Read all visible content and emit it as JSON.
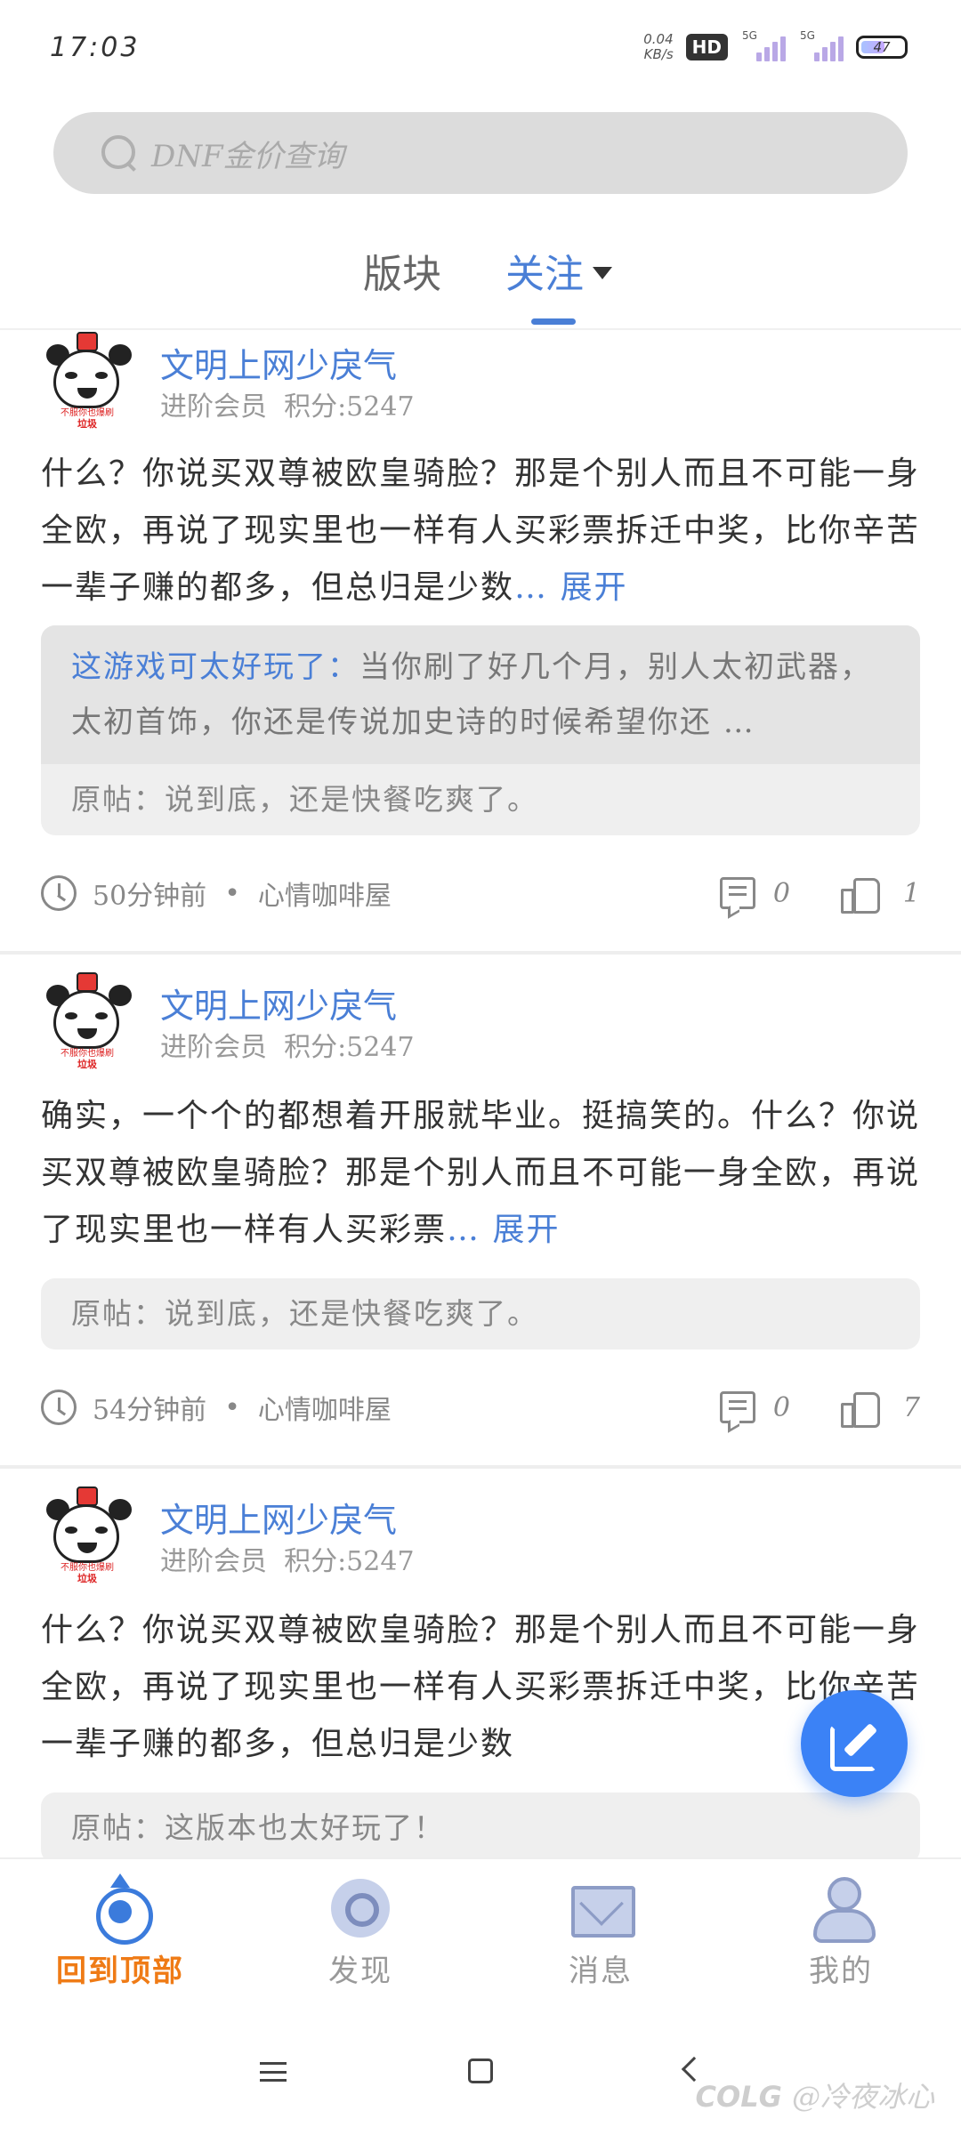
{
  "status_bar": {
    "time": "17:03",
    "net_speed_value": "0.04",
    "net_speed_unit": "KB/s",
    "hd_label": "HD",
    "signal1_label": "5G",
    "signal2_label": "5G",
    "battery": "47"
  },
  "search": {
    "placeholder": "DNF金价查询"
  },
  "tabs": [
    {
      "label": "版块",
      "active": false
    },
    {
      "label": "关注",
      "active": true
    }
  ],
  "posts": [
    {
      "author": "文明上网少戾气",
      "level": "进阶会员",
      "points": "积分:5247",
      "avatar_caption_top": "不服你也爆刷",
      "avatar_caption_bottom": "垃圾",
      "content": "什么？你说买双尊被欧皇骑脸？那是个别人而且不可能一身全欧，再说了现实里也一样有人买彩票拆迁中奖，比你辛苦一辈子赚的都多，但总归是少数",
      "expand": "… 展开",
      "reply_to": "这游戏可太好玩了：",
      "reply_text": "当你刷了好几个月，别人太初武器，太初首饰，你还是传说加史诗的时候希望你还 …",
      "original": "原帖：说到底，还是快餐吃爽了。",
      "time": "50分钟前",
      "board": "心情咖啡屋",
      "comments": "0",
      "likes": "1"
    },
    {
      "author": "文明上网少戾气",
      "level": "进阶会员",
      "points": "积分:5247",
      "avatar_caption_top": "不服你也爆刷",
      "avatar_caption_bottom": "垃圾",
      "content": "确实，一个个的都想着开服就毕业。挺搞笑的。什么？你说买双尊被欧皇骑脸？那是个别人而且不可能一身全欧，再说了现实里也一样有人买彩票",
      "expand": "… 展开",
      "original": "原帖：说到底，还是快餐吃爽了。",
      "time": "54分钟前",
      "board": "心情咖啡屋",
      "comments": "0",
      "likes": "7"
    },
    {
      "author": "文明上网少戾气",
      "level": "进阶会员",
      "points": "积分:5247",
      "avatar_caption_top": "不服你也爆刷",
      "avatar_caption_bottom": "垃圾",
      "content": "什么？你说买双尊被欧皇骑脸？那是个别人而且不可能一身全欧，再说了现实里也一样有人买彩票拆迁中奖，比你辛苦一辈子赚的都多，但总归是少数",
      "original": "原帖：这版本也太好玩了！"
    }
  ],
  "bottom_nav": [
    {
      "label": "回到顶部",
      "icon": "back-to-top-icon",
      "active": true
    },
    {
      "label": "发现",
      "icon": "discover-icon",
      "active": false
    },
    {
      "label": "消息",
      "icon": "message-icon",
      "active": false
    },
    {
      "label": "我的",
      "icon": "profile-icon",
      "active": false
    }
  ],
  "watermark": {
    "brand": "COLG",
    "user": "@冷夜冰心"
  },
  "colors": {
    "accent": "#4a7fd6",
    "active_nav": "#ef7b16",
    "fab": "#3b82f6"
  }
}
